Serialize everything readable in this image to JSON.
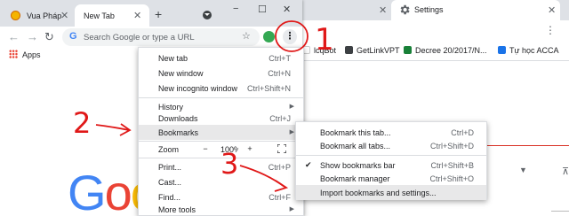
{
  "front_window": {
    "tabs": [
      {
        "title": "Vua Pháp"
      },
      {
        "title": "New Tab"
      }
    ],
    "window_controls": {
      "minimize": "−",
      "maximize": "☐",
      "close": "✕"
    },
    "omnibox_placeholder": "Search Google or type a URL",
    "bookmarks_bar": {
      "apps_label": "Apps"
    },
    "google_logo_letters": [
      {
        "char": "G",
        "color": "#4285f4"
      },
      {
        "char": "o",
        "color": "#ea4335"
      },
      {
        "char": "o",
        "color": "#fbbc05"
      }
    ]
  },
  "back_window": {
    "settings_tab": "Settings",
    "bookmarks": [
      {
        "label": "lcqBot",
        "color": "#ffffff"
      },
      {
        "label": "GetLinkVPT",
        "color": "#3c4043"
      },
      {
        "label": "Decree 20/2017/N...",
        "color": "#188038"
      },
      {
        "label": "Tự học ACCA",
        "color": "#1a73e8"
      }
    ]
  },
  "menu": {
    "items": [
      {
        "label": "New tab",
        "shortcut": "Ctrl+T"
      },
      {
        "label": "New window",
        "shortcut": "Ctrl+N"
      },
      {
        "label": "New incognito window",
        "shortcut": "Ctrl+Shift+N"
      },
      {
        "label": "History",
        "arrow": "▶"
      },
      {
        "label": "Downloads",
        "shortcut": "Ctrl+J"
      },
      {
        "label": "Bookmarks",
        "arrow": "▶"
      },
      {
        "label": "Print...",
        "shortcut": "Ctrl+P"
      },
      {
        "label": "Cast..."
      },
      {
        "label": "Find...",
        "shortcut": "Ctrl+F"
      },
      {
        "label": "More tools",
        "arrow": "▶"
      }
    ],
    "zoom": {
      "label": "Zoom",
      "minus": "−",
      "value": "100%",
      "plus": "+"
    }
  },
  "submenu": {
    "items": [
      {
        "label": "Bookmark this tab...",
        "shortcut": "Ctrl+D"
      },
      {
        "label": "Bookmark all tabs...",
        "shortcut": "Ctrl+Shift+D"
      },
      {
        "label": "Show bookmarks bar",
        "shortcut": "Ctrl+Shift+B",
        "check": "✔"
      },
      {
        "label": "Bookmark manager",
        "shortcut": "Ctrl+Shift+O"
      },
      {
        "label": "Import bookmarks and settings..."
      }
    ]
  },
  "annotations": {
    "step1": "1",
    "step2": "2",
    "step3": "3",
    "color": "#e01818"
  },
  "colors": {
    "tabstrip": "#dee1e6",
    "highlight": "#e8e8e9",
    "accent_blue": "#4285f4"
  }
}
